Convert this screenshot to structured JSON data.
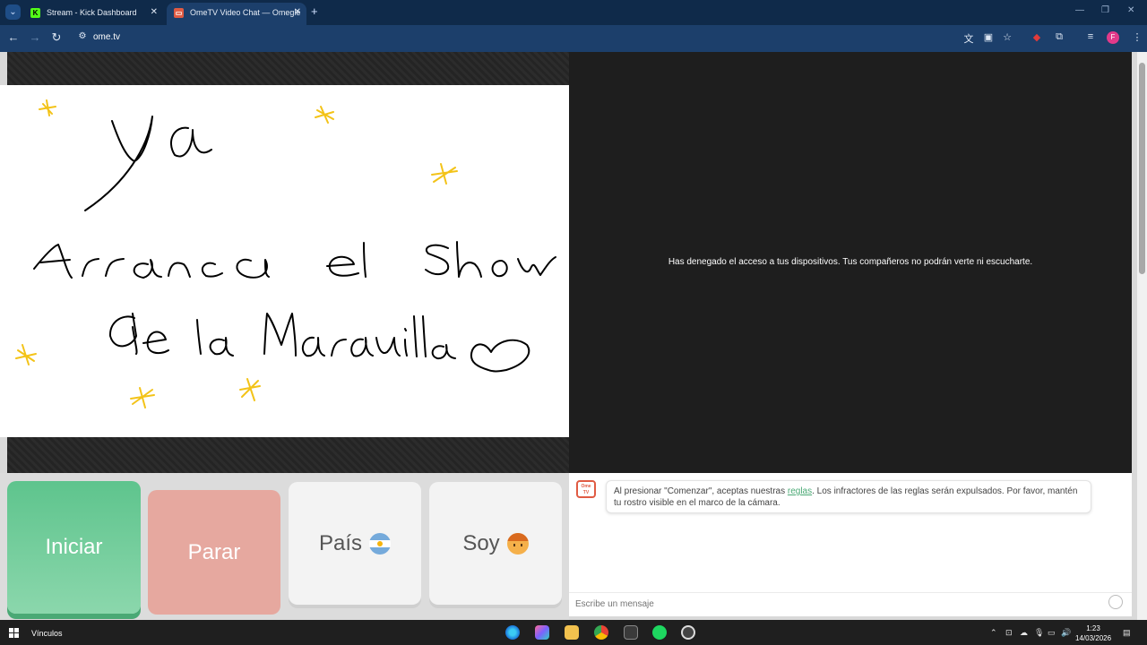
{
  "browser": {
    "tabs": [
      {
        "title": "Stream - Kick Dashboard",
        "active": false,
        "favicon": "kick-icon",
        "favicon_color": "#53fc18"
      },
      {
        "title": "OmeTV Video Chat — Omegle",
        "active": true,
        "favicon": "ometv-icon",
        "favicon_color": "#e05b43"
      }
    ],
    "url": "ome.tv",
    "profile_initial": "F"
  },
  "video": {
    "denied_message": "Has denegado el acceso a tus dispositivos. Tus compañeros no podrán verte ni escucharte.",
    "drawing_lines": [
      "ya",
      "Arranca el show",
      "de la Maravilla"
    ]
  },
  "controls": {
    "start_label": "Iniciar",
    "stop_label": "Parar",
    "country_label": "País",
    "gender_label": "Soy",
    "start_color": "#5ec48d",
    "stop_color": "#e6a89f"
  },
  "chat": {
    "logo_text": "Ome TV",
    "notice_before": "Al presionar \"Comenzar\", aceptas nuestras ",
    "notice_link": "reglas",
    "notice_after": ". Los infractores de las reglas serán expulsados. Por favor, mantén tu rostro visible en el marco de la cámara.",
    "input_placeholder": "Escribe un mensaje"
  },
  "taskbar": {
    "label": "Vínculos",
    "time": "1:23",
    "date": "14/03/2026"
  }
}
